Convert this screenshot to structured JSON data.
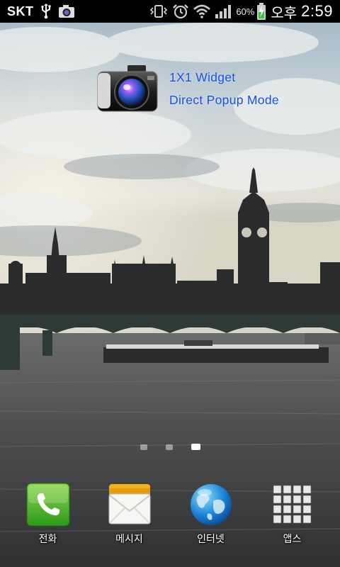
{
  "status_bar": {
    "carrier": "SKT",
    "battery_percent": "60%",
    "ampm": "오후",
    "time": "2:59",
    "icons": [
      "usb-icon",
      "camera-notification-icon",
      "vibrate-icon",
      "alarm-icon",
      "wifi-icon",
      "signal-icon",
      "battery-charging-icon"
    ]
  },
  "widget": {
    "line1": "1X1 Widget",
    "line2": "Direct Popup Mode",
    "icon": "camera-icon",
    "text_color": "#1750e6"
  },
  "page_indicator": {
    "count": 3,
    "active": 3
  },
  "dock": {
    "items": [
      {
        "label": "전화",
        "icon": "phone-icon"
      },
      {
        "label": "메시지",
        "icon": "message-icon"
      },
      {
        "label": "인터넷",
        "icon": "globe-icon"
      },
      {
        "label": "앱스",
        "icon": "apps-grid-icon"
      }
    ]
  }
}
